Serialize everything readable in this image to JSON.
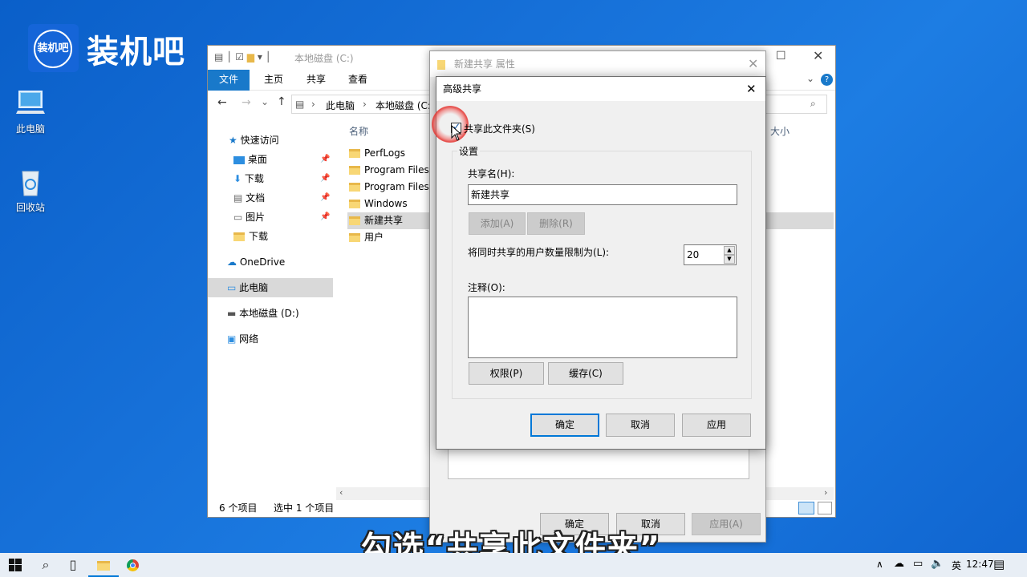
{
  "brand": {
    "logo_badge": "装机吧",
    "logo_text": "装机吧"
  },
  "desktop": {
    "icons": [
      {
        "label": "此电脑"
      },
      {
        "label": "回收站"
      }
    ]
  },
  "explorer": {
    "title": "本地磁盘 (C:)",
    "ribbon_tabs": [
      "文件",
      "主页",
      "共享",
      "查看"
    ],
    "breadcrumb": [
      "此电脑",
      "本地磁盘 (C:"
    ],
    "nav": {
      "quick_access": "快速访问",
      "items": [
        "桌面",
        "下载",
        "文档",
        "图片",
        "下载"
      ],
      "onedrive": "OneDrive",
      "this_pc": "此电脑",
      "drive_d": "本地磁盘 (D:)",
      "network": "网络"
    },
    "columns": {
      "name": "名称",
      "size": "大小"
    },
    "files": [
      "PerfLogs",
      "Program Files",
      "Program Files",
      "Windows",
      "新建共享",
      "用户"
    ],
    "status": {
      "count": "6 个项目",
      "selected": "选中 1 个项目"
    }
  },
  "properties": {
    "title": "新建共享 属性",
    "buttons": {
      "ok": "确定",
      "cancel": "取消",
      "apply": "应用(A)"
    }
  },
  "advanced": {
    "title": "高级共享",
    "share_checkbox": "共享此文件夹(S)",
    "settings_group": "设置",
    "share_name_label": "共享名(H):",
    "share_name_value": "新建共享",
    "add_button": "添加(A)",
    "remove_button": "删除(R)",
    "limit_label": "将同时共享的用户数量限制为(L):",
    "limit_value": "20",
    "comment_label": "注释(O):",
    "permissions_button": "权限(P)",
    "cache_button": "缓存(C)",
    "ok": "确定",
    "cancel": "取消",
    "apply": "应用"
  },
  "taskbar": {
    "time": "12:47"
  },
  "caption": "勾选“共享此文件夹”",
  "colors": {
    "accent": "#0078d7",
    "desktop": "#1670d8",
    "highlight_ring": "#e53935"
  }
}
